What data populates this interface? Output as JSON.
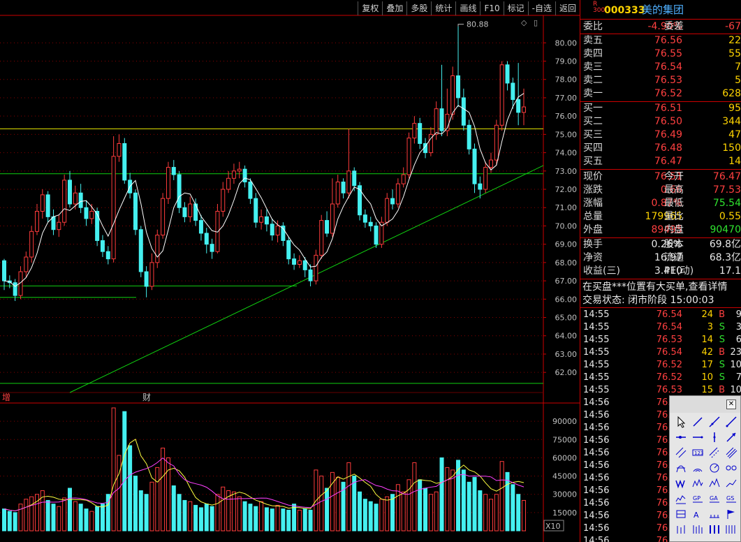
{
  "toolbar": [
    "复权",
    "叠加",
    "多股",
    "统计",
    "画线",
    "F10",
    "标记",
    "-自选",
    "返回"
  ],
  "chart": {
    "price_ticks": [
      "80.00",
      "79.00",
      "78.00",
      "77.00",
      "76.00",
      "75.00",
      "74.00",
      "73.00",
      "72.00",
      "71.00",
      "70.00",
      "69.00",
      "68.00",
      "67.00",
      "66.00",
      "65.00",
      "64.00",
      "63.00",
      "62.00"
    ],
    "vol_ticks": [
      "90000",
      "75000",
      "60000",
      "45000",
      "30000",
      "15000"
    ],
    "vol_unit": "X10",
    "high_label": "80.88",
    "tag_zeng": "增",
    "tag_cai": "财",
    "colors": {
      "up": "#ff3c3c",
      "down": "#45f0f0",
      "ma": "#ffffff",
      "ma2": "#ffff40",
      "ma3": "#ff40ff",
      "hline_yellow": "#e0e000",
      "hline_green": "#10d010"
    }
  },
  "stock": {
    "badge_r": "R",
    "badge_num": "300",
    "code": "000333",
    "name": "美的集团"
  },
  "weibi": {
    "label": "委比",
    "value": "-4.90%",
    "label2": "委差",
    "value2": "-67"
  },
  "asks": [
    {
      "label": "卖五",
      "price": "76.56",
      "vol": "22"
    },
    {
      "label": "卖四",
      "price": "76.55",
      "vol": "55"
    },
    {
      "label": "卖三",
      "price": "76.54",
      "vol": "7"
    },
    {
      "label": "卖二",
      "price": "76.53",
      "vol": "5"
    },
    {
      "label": "卖一",
      "price": "76.52",
      "vol": "628"
    }
  ],
  "bids": [
    {
      "label": "买一",
      "price": "76.51",
      "vol": "95"
    },
    {
      "label": "买二",
      "price": "76.50",
      "vol": "344"
    },
    {
      "label": "买三",
      "price": "76.49",
      "vol": "47"
    },
    {
      "label": "买四",
      "price": "76.48",
      "vol": "150"
    },
    {
      "label": "买五",
      "price": "76.47",
      "vol": "14"
    }
  ],
  "quote": [
    {
      "l1": "现价",
      "v1": "76.51",
      "c1": "red",
      "l2": "今开",
      "v2": "76.47",
      "c2": "red"
    },
    {
      "l1": "涨跌",
      "v1": "0.66",
      "c1": "red",
      "l2": "最高",
      "v2": "77.53",
      "c2": "red"
    },
    {
      "l1": "涨幅",
      "v1": "0.87%",
      "c1": "red",
      "l2": "最低",
      "v2": "75.54",
      "c2": "green"
    },
    {
      "l1": "总量",
      "v1": "179965",
      "c1": "yellow",
      "l2": "量比",
      "v2": "0.55",
      "c2": "yellow"
    },
    {
      "l1": "外盘",
      "v1": "89495",
      "c1": "red",
      "l2": "内盘",
      "v2": "90470",
      "c2": "green"
    }
  ],
  "fund": [
    {
      "l1": "换手",
      "v1": "0.26%",
      "l2": "股本",
      "v2": "69.8亿"
    },
    {
      "l1": "净资",
      "v1": "16.97",
      "l2": "流通",
      "v2": "68.3亿"
    },
    {
      "l1": "收益(三)",
      "v1": "3.410",
      "l2": "PE(动)",
      "v2": "17.1"
    }
  ],
  "notice": "在买盘***位置有大买单,查看详情",
  "status": "交易状态: 闭市阶段 15:00:03",
  "ticks": [
    {
      "t": "14:55",
      "p": "76.54",
      "v": "24",
      "bs": "B",
      "n": "9"
    },
    {
      "t": "14:55",
      "p": "76.54",
      "v": "3",
      "bs": "S",
      "n": "3"
    },
    {
      "t": "14:55",
      "p": "76.53",
      "v": "14",
      "bs": "S",
      "n": "6"
    },
    {
      "t": "14:55",
      "p": "76.54",
      "v": "42",
      "bs": "B",
      "n": "23"
    },
    {
      "t": "14:55",
      "p": "76.52",
      "v": "17",
      "bs": "S",
      "n": "10"
    },
    {
      "t": "14:55",
      "p": "76.52",
      "v": "10",
      "bs": "S",
      "n": "7"
    },
    {
      "t": "14:55",
      "p": "76.53",
      "v": "15",
      "bs": "B",
      "n": "10"
    },
    {
      "t": "14:56",
      "p": "76.54"
    },
    {
      "t": "14:56",
      "p": "76.52"
    },
    {
      "t": "14:56",
      "p": "76.52"
    },
    {
      "t": "14:56",
      "p": "76.55"
    },
    {
      "t": "14:56",
      "p": "76.52"
    },
    {
      "t": "14:56",
      "p": "76.53"
    },
    {
      "t": "14:56",
      "p": "76.53"
    },
    {
      "t": "14:56",
      "p": "76.53"
    },
    {
      "t": "14:56",
      "p": "76.53"
    },
    {
      "t": "14:56",
      "p": "76.50"
    },
    {
      "t": "14:56",
      "p": "76.50"
    },
    {
      "t": "14:56",
      "p": "76.50"
    }
  ],
  "draw_tools": [
    "cursor-tool",
    "segment-tool",
    "line-tool",
    "ray-tool",
    "price-line-tool",
    "hline-tool",
    "vline-tool",
    "arrow-tool",
    "parallel-tool",
    "label-tool",
    "channel-tool",
    "channel2-tool",
    "fib-tool",
    "arc-tool",
    "circle-tool",
    "cycle-tool",
    "wave-tool",
    "zigzag-tool",
    "peak-tool",
    "trend-tool",
    "gann-tool",
    "gp-tool",
    "ga-tool",
    "gs-tool",
    "box-tool",
    "text-tool",
    "ruler-tool",
    "flag-tool",
    "bar-tool",
    "bars2-tool",
    "bars3-tool",
    "bars4-tool"
  ],
  "chart_data": {
    "type": "candlestick",
    "ylim": [
      60.9,
      81.5
    ],
    "vol_max": 101000,
    "candles": [
      [
        68.1,
        67.0,
        68.2,
        66.5
      ],
      [
        67.0,
        66.9,
        67.3,
        66.6
      ],
      [
        66.9,
        66.2,
        67.1,
        65.9
      ],
      [
        66.2,
        67.5,
        67.8,
        66.0
      ],
      [
        67.5,
        68.3,
        68.6,
        67.2
      ],
      [
        68.3,
        69.7,
        70.0,
        68.0
      ],
      [
        69.7,
        70.8,
        71.2,
        69.5
      ],
      [
        70.8,
        71.7,
        72.0,
        70.4
      ],
      [
        71.7,
        70.5,
        71.9,
        70.2
      ],
      [
        70.5,
        69.8,
        70.9,
        69.5
      ],
      [
        69.8,
        70.2,
        70.6,
        69.4
      ],
      [
        70.2,
        72.5,
        72.8,
        70.0
      ],
      [
        72.5,
        71.2,
        73.0,
        71.0
      ],
      [
        71.2,
        71.8,
        72.2,
        70.9
      ],
      [
        71.8,
        71.0,
        72.3,
        70.7
      ],
      [
        71.0,
        70.4,
        71.4,
        70.0
      ],
      [
        70.4,
        70.8,
        71.2,
        70.1
      ],
      [
        70.8,
        69.2,
        71.0,
        68.9
      ],
      [
        69.2,
        68.6,
        69.5,
        68.3
      ],
      [
        68.6,
        68.2,
        68.9,
        67.9
      ],
      [
        68.2,
        73.8,
        74.9,
        68.0
      ],
      [
        73.8,
        74.5,
        75.0,
        73.5
      ],
      [
        74.5,
        72.5,
        74.8,
        72.3
      ],
      [
        72.5,
        71.8,
        72.9,
        71.5
      ],
      [
        71.8,
        69.8,
        72.0,
        69.5
      ],
      [
        69.8,
        67.5,
        70.0,
        67.2
      ],
      [
        67.5,
        66.7,
        67.8,
        66.1
      ],
      [
        66.7,
        68.0,
        68.5,
        66.5
      ],
      [
        68.0,
        69.5,
        69.8,
        67.7
      ],
      [
        69.5,
        71.5,
        71.8,
        69.3
      ],
      [
        71.5,
        73.2,
        73.5,
        71.2
      ],
      [
        73.2,
        72.8,
        73.6,
        72.5
      ],
      [
        72.8,
        71.0,
        73.0,
        70.7
      ],
      [
        71.0,
        70.5,
        71.3,
        70.2
      ],
      [
        70.5,
        71.2,
        71.6,
        70.2
      ],
      [
        71.2,
        70.3,
        71.5,
        70.0
      ],
      [
        70.3,
        69.6,
        70.6,
        69.2
      ],
      [
        69.6,
        69.0,
        69.9,
        68.5
      ],
      [
        69.0,
        68.6,
        69.3,
        68.2
      ],
      [
        68.6,
        70.8,
        71.2,
        68.5
      ],
      [
        70.8,
        72.0,
        72.4,
        70.5
      ],
      [
        72.0,
        72.6,
        73.0,
        71.8
      ],
      [
        72.6,
        73.0,
        73.4,
        72.3
      ],
      [
        73.0,
        73.1,
        73.5,
        72.6
      ],
      [
        73.1,
        72.4,
        73.3,
        72.1
      ],
      [
        72.4,
        71.5,
        72.6,
        71.2
      ],
      [
        71.5,
        70.2,
        71.8,
        69.9
      ],
      [
        70.2,
        70.5,
        70.9,
        69.8
      ],
      [
        70.5,
        70.1,
        70.9,
        69.7
      ],
      [
        70.1,
        69.5,
        70.4,
        69.2
      ],
      [
        69.5,
        70.0,
        70.3,
        69.1
      ],
      [
        70.0,
        69.2,
        70.2,
        68.9
      ],
      [
        69.2,
        68.2,
        69.4,
        67.9
      ],
      [
        68.2,
        67.9,
        68.5,
        67.6
      ],
      [
        67.9,
        68.1,
        68.4,
        67.7
      ],
      [
        68.1,
        67.6,
        68.3,
        67.2
      ],
      [
        67.6,
        67.0,
        67.9,
        66.7
      ],
      [
        67.0,
        68.4,
        68.7,
        66.8
      ],
      [
        68.4,
        70.3,
        70.6,
        68.2
      ],
      [
        70.3,
        69.6,
        70.8,
        69.4
      ],
      [
        69.6,
        71.2,
        72.6,
        69.4
      ],
      [
        71.2,
        72.4,
        72.8,
        71.0
      ],
      [
        72.4,
        71.8,
        72.6,
        71.5
      ],
      [
        71.8,
        73.0,
        75.3,
        71.5
      ],
      [
        73.0,
        72.2,
        73.2,
        71.9
      ],
      [
        72.2,
        70.6,
        72.4,
        70.3
      ],
      [
        70.6,
        70.2,
        70.9,
        69.9
      ],
      [
        70.2,
        70.0,
        70.5,
        69.7
      ],
      [
        70.0,
        69.0,
        70.2,
        68.8
      ],
      [
        69.0,
        70.2,
        70.5,
        68.8
      ],
      [
        70.2,
        71.5,
        71.8,
        70.0
      ],
      [
        71.5,
        71.2,
        72.0,
        70.9
      ],
      [
        71.2,
        72.3,
        72.6,
        71.0
      ],
      [
        72.3,
        72.8,
        73.2,
        72.1
      ],
      [
        72.8,
        74.8,
        75.1,
        72.6
      ],
      [
        74.8,
        75.6,
        76.0,
        74.5
      ],
      [
        75.6,
        74.5,
        75.9,
        74.2
      ],
      [
        74.5,
        74.0,
        74.8,
        73.7
      ],
      [
        74.0,
        75.0,
        75.4,
        73.8
      ],
      [
        75.0,
        76.4,
        76.8,
        74.7
      ],
      [
        76.4,
        75.2,
        78.8,
        74.9
      ],
      [
        75.2,
        76.1,
        77.5,
        74.9
      ],
      [
        76.1,
        78.2,
        78.7,
        75.8
      ],
      [
        78.2,
        77.0,
        80.9,
        76.5
      ],
      [
        77.0,
        75.5,
        77.5,
        75.2
      ],
      [
        75.5,
        74.2,
        75.8,
        73.9
      ],
      [
        74.2,
        72.3,
        74.5,
        71.8
      ],
      [
        72.3,
        72.0,
        72.7,
        71.5
      ],
      [
        72.0,
        73.2,
        73.5,
        71.8
      ],
      [
        73.2,
        73.6,
        74.0,
        72.9
      ],
      [
        73.6,
        75.5,
        75.8,
        73.3
      ],
      [
        75.5,
        78.8,
        79.0,
        75.2
      ],
      [
        78.8,
        77.8,
        79.0,
        77.4
      ],
      [
        77.8,
        76.9,
        78.1,
        76.4
      ],
      [
        76.9,
        76.2,
        78.9,
        75.5
      ],
      [
        76.2,
        76.5,
        77.5,
        75.5
      ]
    ],
    "volumes": [
      18000,
      16000,
      15000,
      22000,
      26000,
      28000,
      30000,
      33000,
      25000,
      22000,
      20000,
      27000,
      35000,
      24000,
      22000,
      18000,
      16000,
      20000,
      22000,
      30000,
      101000,
      62000,
      98000,
      70000,
      45000,
      33000,
      30000,
      40000,
      52000,
      68000,
      60000,
      37000,
      30000,
      25000,
      24000,
      21000,
      19000,
      22000,
      20000,
      30000,
      36000,
      33000,
      32000,
      28000,
      24000,
      22000,
      20000,
      24000,
      19000,
      18000,
      21000,
      18000,
      17000,
      22000,
      17000,
      18000,
      17000,
      50000,
      45000,
      35000,
      48000,
      44000,
      40000,
      56000,
      45000,
      32000,
      26000,
      24000,
      22000,
      26000,
      28000,
      30000,
      38000,
      32000,
      42000,
      56000,
      42000,
      35000,
      30000,
      32000,
      60000,
      52000,
      50000,
      58000,
      50000,
      40000,
      44000,
      33000,
      30000,
      26000,
      30000,
      57000,
      48000,
      38000,
      30000,
      25000
    ]
  }
}
